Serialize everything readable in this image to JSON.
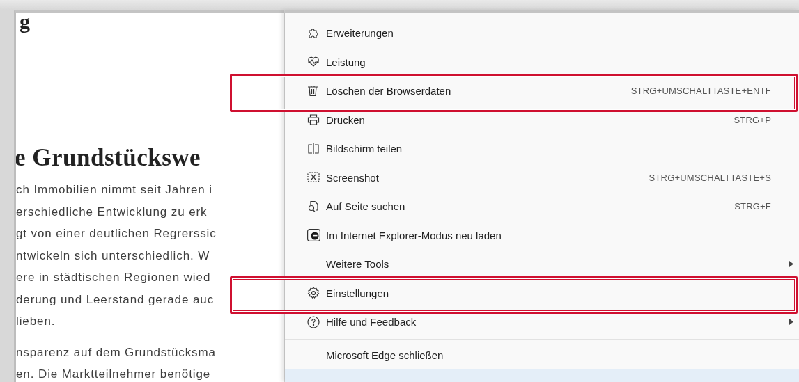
{
  "page": {
    "title_fragment": "g",
    "heading": "e Grundstückswe",
    "paragraphs": [
      [
        "ch Immobilien nimmt seit Jahren i",
        "erschiedliche Entwicklung zu erk",
        "gt von einer deutlichen Regrerssic",
        "ntwickeln sich  unterschiedlich. W",
        "ere in städtischen Regionen wied",
        "derung und Leerstand gerade auc",
        "lieben."
      ],
      [
        "nsparenz auf dem Grundstücksma",
        "en. Die Marktteilnehmer benötige"
      ]
    ]
  },
  "menu": {
    "items": [
      {
        "label": "Erweiterungen",
        "highlighted": false
      },
      {
        "label": "Leistung",
        "highlighted": false
      },
      {
        "label": "Löschen der Browserdaten",
        "shortcut": "STRG+UMSCHALTTASTE+ENTF",
        "highlighted": true
      },
      {
        "label": "Drucken",
        "shortcut": "STRG+P",
        "highlighted": false
      },
      {
        "label": "Bildschirm teilen",
        "highlighted": false
      },
      {
        "label": "Screenshot",
        "shortcut": "STRG+UMSCHALTTASTE+S",
        "highlighted": false
      },
      {
        "label": "Auf Seite suchen",
        "shortcut": "STRG+F",
        "highlighted": false
      },
      {
        "label": "Im Internet Explorer-Modus neu laden",
        "highlighted": false
      },
      {
        "label": "Weitere Tools",
        "submenu": true,
        "highlighted": false
      },
      {
        "label": "Einstellungen",
        "highlighted": true
      },
      {
        "label": "Hilfe und Feedback",
        "submenu": true,
        "highlighted": false
      },
      {
        "label": "Microsoft Edge schließen",
        "separator_before": true,
        "highlighted": false
      }
    ]
  }
}
